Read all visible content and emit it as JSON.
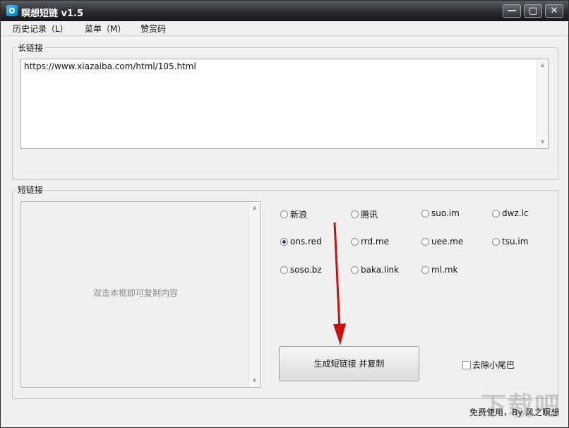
{
  "window": {
    "title": "瞑想短链 v1.5"
  },
  "titlebar_buttons": {
    "minimize": "—",
    "maximize": "□",
    "close": "✕"
  },
  "menu": {
    "history": "历史记录（L）",
    "menu": "菜单（M）",
    "donate": "赞赏码"
  },
  "long_link": {
    "label": "长链接",
    "value": "https://www.xiazaiba.com/html/105.html"
  },
  "short_link": {
    "label": "短链接",
    "hint": "双击本框即可复制内容"
  },
  "services": [
    {
      "label": "新浪",
      "checked": false
    },
    {
      "label": "腾讯",
      "checked": false
    },
    {
      "label": "suo.im",
      "checked": false
    },
    {
      "label": "dwz.lc",
      "checked": false
    },
    {
      "label": "ons.red",
      "checked": true
    },
    {
      "label": "rrd.me",
      "checked": false
    },
    {
      "label": "uee.me",
      "checked": false
    },
    {
      "label": "tsu.im",
      "checked": false
    },
    {
      "label": "soso.bz",
      "checked": false
    },
    {
      "label": "baka.link",
      "checked": false
    },
    {
      "label": "ml.mk",
      "checked": false
    }
  ],
  "actions": {
    "generate": "生成短链接 并复制",
    "remove_tail": "去除小尾巴"
  },
  "footer": {
    "text": "免费使用，By 风之瞑想"
  },
  "watermark": {
    "text": "下载吧"
  },
  "colors": {
    "arrow": "#cc1111",
    "titlebar": "#2a2c30"
  }
}
